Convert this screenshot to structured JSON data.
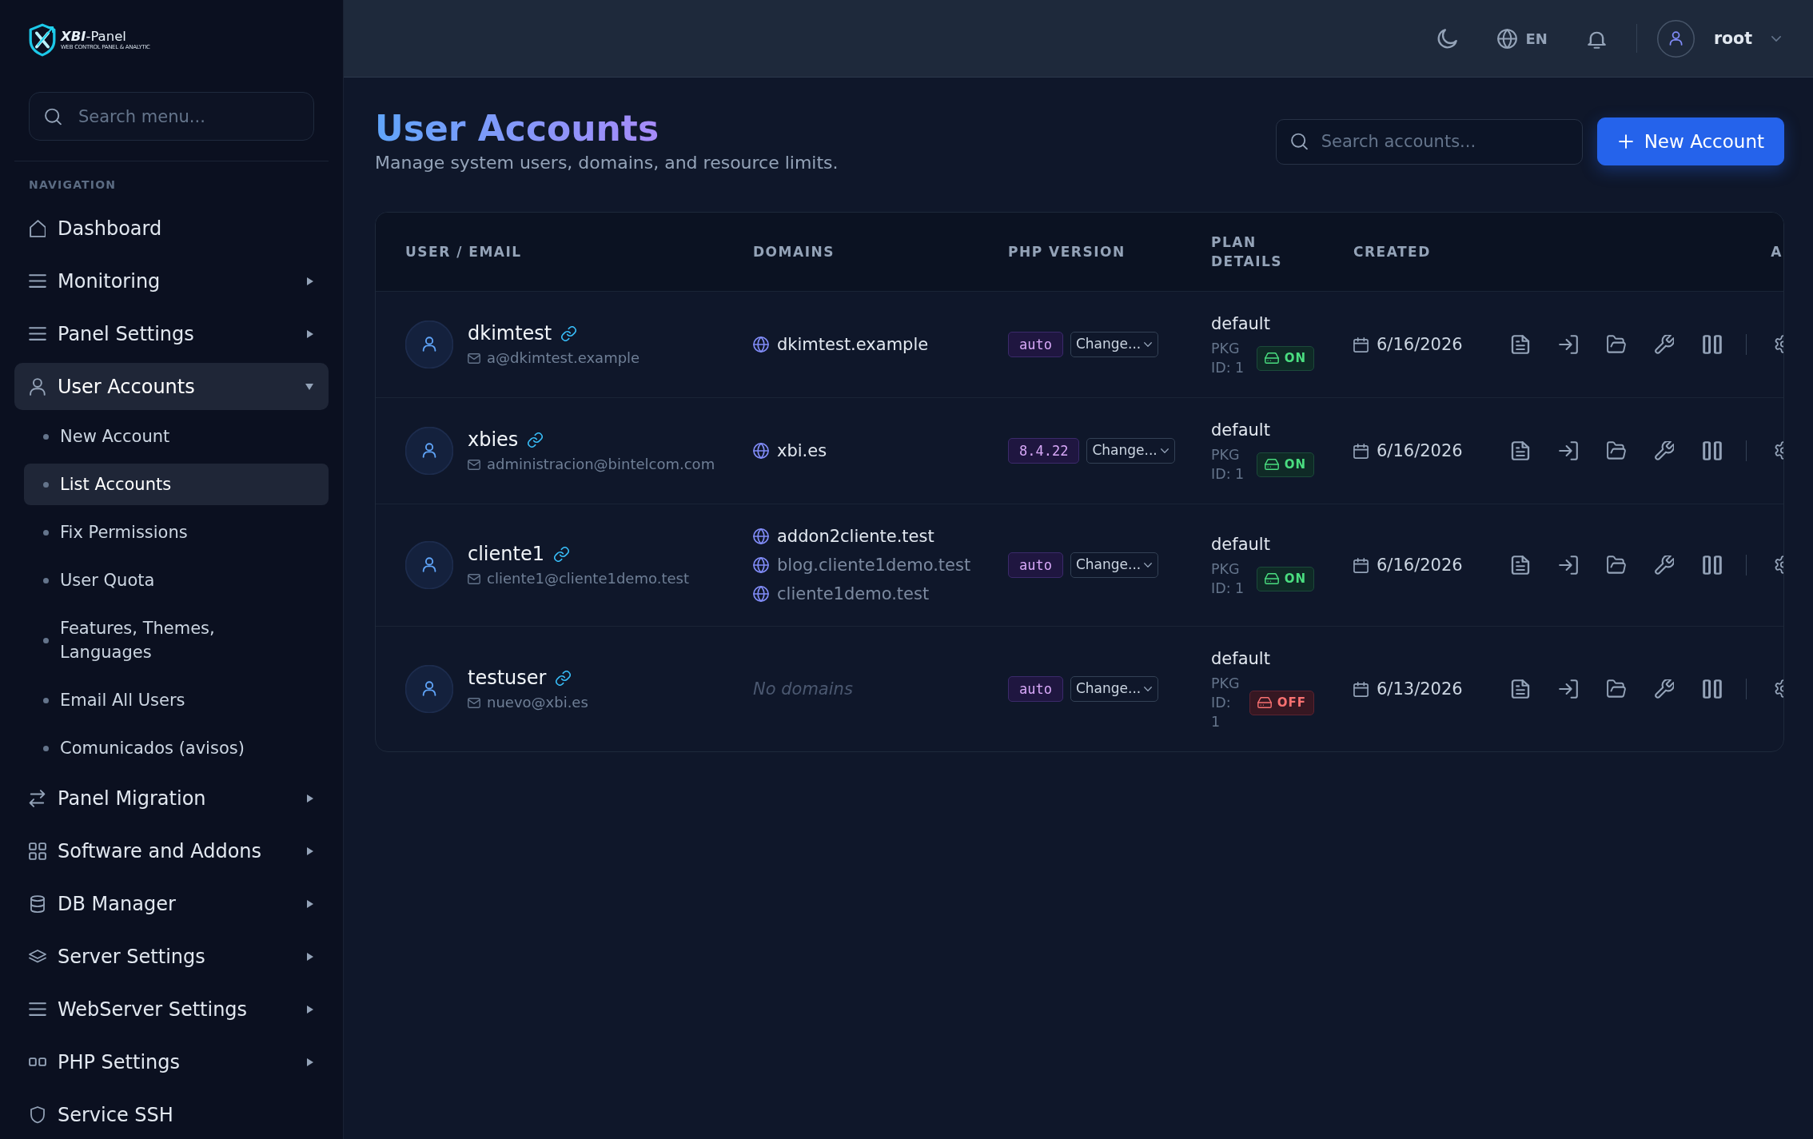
{
  "sidebar": {
    "logo": {
      "name": "**XBI**-Panel",
      "tagline": "WEB CONTROL PANEL & ANALYTIC"
    },
    "search": {
      "placeholder": "Search menu..."
    },
    "section_label": "NAVIGATION",
    "items": [
      {
        "label": "Dashboard",
        "kind": "link",
        "selected": false
      },
      {
        "label": "Monitoring",
        "kind": "group",
        "expanded": false,
        "selected": false
      },
      {
        "label": "Panel Settings",
        "kind": "group",
        "expanded": false,
        "selected": false
      },
      {
        "label": "User Accounts",
        "kind": "group",
        "expanded": true,
        "selected": true,
        "children": [
          {
            "label": "New Account",
            "selected": false
          },
          {
            "label": "List Accounts",
            "selected": true
          },
          {
            "label": "Fix Permissions",
            "selected": false
          },
          {
            "label": "User Quota",
            "selected": false
          },
          {
            "label": "Features, Themes, Languages",
            "selected": false
          },
          {
            "label": "Email All Users",
            "selected": false
          },
          {
            "label": "Comunicados (avisos)",
            "selected": false
          }
        ]
      },
      {
        "label": "Panel Migration",
        "kind": "group",
        "expanded": false,
        "selected": false
      },
      {
        "label": "Software and Addons",
        "kind": "group",
        "expanded": false,
        "selected": false
      },
      {
        "label": "DB Manager",
        "kind": "group",
        "expanded": false,
        "selected": false
      },
      {
        "label": "Server Settings",
        "kind": "group",
        "expanded": false,
        "selected": false
      },
      {
        "label": "WebServer Settings",
        "kind": "group",
        "expanded": false,
        "selected": false
      },
      {
        "label": "PHP Settings",
        "kind": "group",
        "expanded": false,
        "selected": false
      },
      {
        "label": "Service SSH",
        "kind": "link",
        "selected": false
      }
    ]
  },
  "topbar": {
    "language": "EN",
    "user": "root"
  },
  "page": {
    "title": "User Accounts",
    "subtitle": "Manage system users, domains, and resource limits.",
    "search": {
      "placeholder": "Search accounts..."
    },
    "primary_button": "New Account"
  },
  "table": {
    "columns": [
      "USER / EMAIL",
      "DOMAINS",
      "PHP VERSION",
      "PLAN DETAILS",
      "CREATED",
      "A"
    ],
    "rows": [
      {
        "user": "dkimtest",
        "email": "a@dkimtest.example",
        "domains": [
          {
            "name": "dkimtest.example",
            "primary": true
          }
        ],
        "php": {
          "version": "auto",
          "action": "Change..."
        },
        "plan": "default",
        "package": "PKG ID: 1",
        "status": {
          "label": "ON",
          "on": true
        },
        "created": "6/16/2026"
      },
      {
        "user": "xbies",
        "email": "administracion@bintelcom.com",
        "domains": [
          {
            "name": "xbi.es",
            "primary": true
          }
        ],
        "php": {
          "version": "8.4.22",
          "action": "Change..."
        },
        "plan": "default",
        "package": "PKG ID: 1",
        "status": {
          "label": "ON",
          "on": true
        },
        "created": "6/16/2026"
      },
      {
        "user": "cliente1",
        "email": "cliente1@cliente1demo.test",
        "domains": [
          {
            "name": "addon2cliente.test",
            "primary": true
          },
          {
            "name": "blog.cliente1demo.test",
            "primary": false
          },
          {
            "name": "cliente1demo.test",
            "primary": false
          }
        ],
        "php": {
          "version": "auto",
          "action": "Change..."
        },
        "plan": "default",
        "package": "PKG ID: 1",
        "status": {
          "label": "ON",
          "on": true
        },
        "created": "6/16/2026"
      },
      {
        "user": "testuser",
        "email": "nuevo@xbi.es",
        "domains_note": "No domains",
        "php": {
          "version": "auto",
          "action": "Change..."
        },
        "plan": "default",
        "package": "PKG ID: 1",
        "status": {
          "label": "OFF",
          "on": false
        },
        "created": "6/13/2026"
      }
    ]
  }
}
